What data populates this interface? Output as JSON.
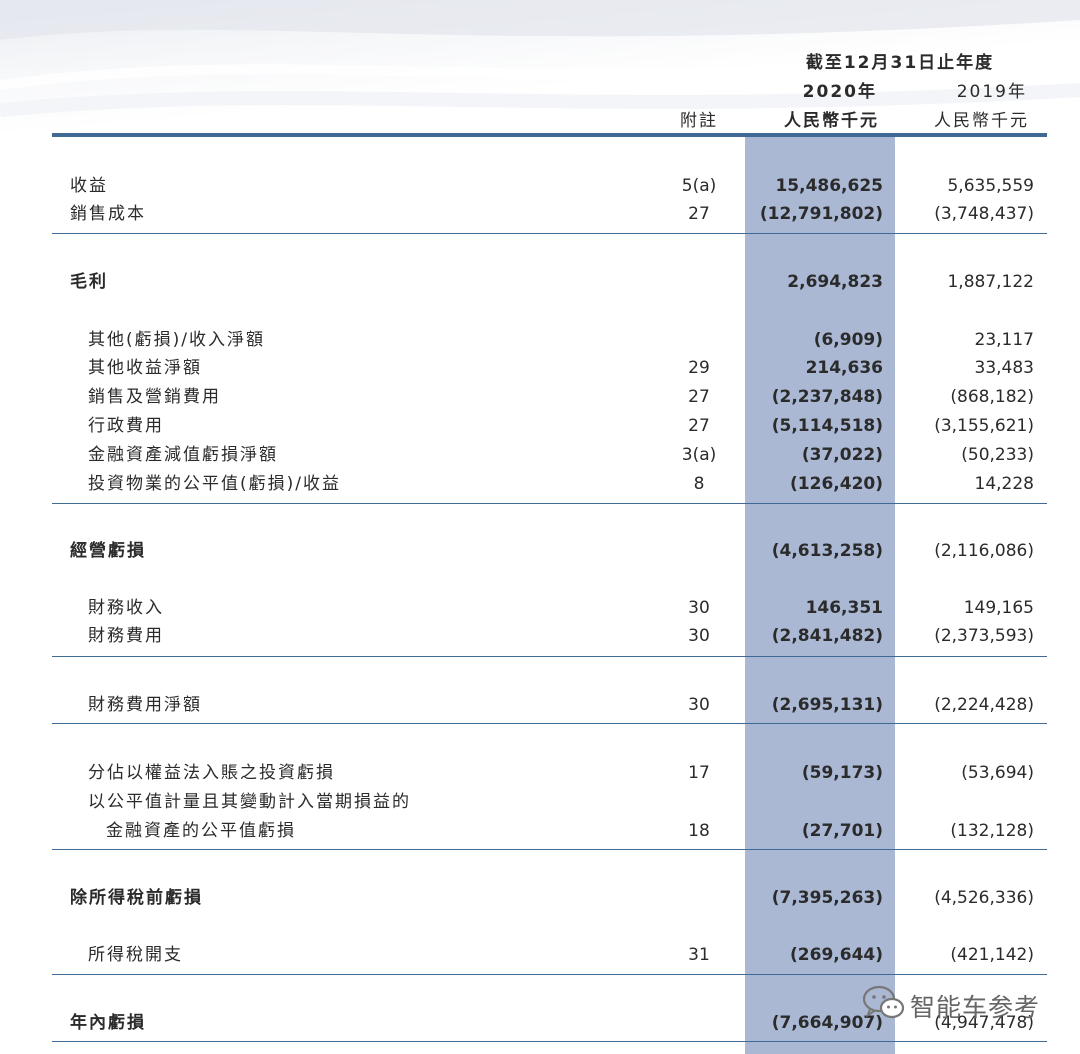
{
  "header": {
    "period": "截至12月31日止年度",
    "note_col": "附註",
    "year_current": "2020年",
    "year_prior": "2019年",
    "unit_current": "人民幣千元",
    "unit_prior": "人民幣千元"
  },
  "colors": {
    "accent": "#3f6a95",
    "shade": "#aab8d4"
  },
  "rows": [
    {
      "label": "收益",
      "note": "5(a)",
      "v2020": "15,486,625",
      "v2019": "5,635,559"
    },
    {
      "label": "銷售成本",
      "note": "27",
      "v2020": "(12,791,802)",
      "v2019": "(3,748,437)"
    },
    {
      "label": "毛利",
      "note": "",
      "v2020": "2,694,823",
      "v2019": "1,887,122"
    },
    {
      "label": "其他(虧損)/收入淨額",
      "note": "",
      "v2020": "(6,909)",
      "v2019": "23,117"
    },
    {
      "label": "其他收益淨額",
      "note": "29",
      "v2020": "214,636",
      "v2019": "33,483"
    },
    {
      "label": "銷售及營銷費用",
      "note": "27",
      "v2020": "(2,237,848)",
      "v2019": "(868,182)"
    },
    {
      "label": "行政費用",
      "note": "27",
      "v2020": "(5,114,518)",
      "v2019": "(3,155,621)"
    },
    {
      "label": "金融資產減值虧損淨額",
      "note": "3(a)",
      "v2020": "(37,022)",
      "v2019": "(50,233)"
    },
    {
      "label": "投資物業的公平值(虧損)/收益",
      "note": "8",
      "v2020": "(126,420)",
      "v2019": "14,228"
    },
    {
      "label": "經營虧損",
      "note": "",
      "v2020": "(4,613,258)",
      "v2019": "(2,116,086)"
    },
    {
      "label": "財務收入",
      "note": "30",
      "v2020": "146,351",
      "v2019": "149,165"
    },
    {
      "label": "財務費用",
      "note": "30",
      "v2020": "(2,841,482)",
      "v2019": "(2,373,593)"
    },
    {
      "label": "財務費用淨額",
      "note": "30",
      "v2020": "(2,695,131)",
      "v2019": "(2,224,428)"
    },
    {
      "label": "分佔以權益法入賬之投資虧損",
      "note": "17",
      "v2020": "(59,173)",
      "v2019": "(53,694)"
    },
    {
      "label": "以公平值計量且其變動計入當期損益的",
      "note": "",
      "v2020": "",
      "v2019": ""
    },
    {
      "label": "金融資產的公平值虧損",
      "note": "18",
      "v2020": "(27,701)",
      "v2019": "(132,128)"
    },
    {
      "label": "除所得稅前虧損",
      "note": "",
      "v2020": "(7,395,263)",
      "v2019": "(4,526,336)"
    },
    {
      "label": "所得稅開支",
      "note": "31",
      "v2020": "(269,644)",
      "v2019": "(421,142)"
    },
    {
      "label": "年內虧損",
      "note": "",
      "v2020": "(7,664,907)",
      "v2019": "(4,947,478)"
    }
  ],
  "watermark": {
    "text": "智能车参考",
    "icon": "wechat-icon"
  }
}
